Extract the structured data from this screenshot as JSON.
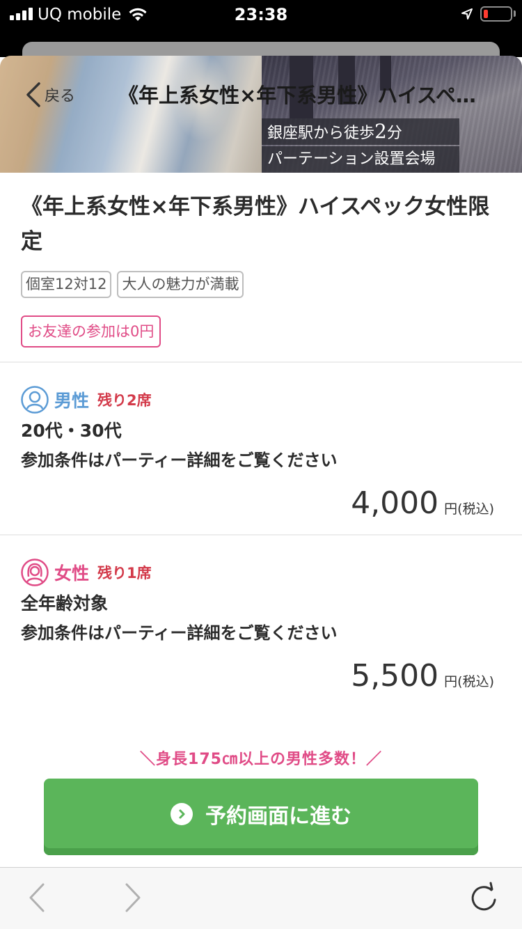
{
  "status_bar": {
    "carrier": "UQ mobile",
    "time": "23:38"
  },
  "header": {
    "back_label": "戻る",
    "title": "《年上系女性×年下系男性》ハイスペ…"
  },
  "banner": {
    "caption1_pre": "銀座駅から徒歩",
    "caption1_num": "2",
    "caption1_post": "分",
    "caption2": "パーテーション設置会場"
  },
  "event": {
    "title": "《年上系女性×年下系男性》ハイスペック女性限定",
    "tags": [
      "個室12対12",
      "大人の魅力が満載"
    ],
    "friend_tag": "お友達の参加は0円"
  },
  "male": {
    "label": "男性",
    "seats": "残り2席",
    "age": "20代・30代",
    "condition": "参加条件はパーティー詳細をご覧ください",
    "price": "4,000",
    "unit": "円(税込)",
    "color": "#5b9bd5"
  },
  "female": {
    "label": "女性",
    "seats": "残り1席",
    "age": "全年齢対象",
    "condition": "参加条件はパーティー詳細をご覧ください",
    "price": "5,500",
    "unit": "円(税込)",
    "color": "#e04b86"
  },
  "promo": "＼身長175㎝以上の男性多数！／",
  "cta": {
    "label": "予約画面に進む"
  },
  "colors": {
    "accent_green": "#5bb55a",
    "seat_red": "#d33a4a"
  }
}
